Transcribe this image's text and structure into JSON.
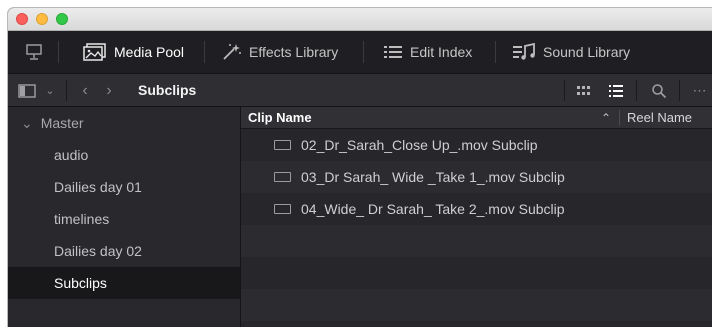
{
  "toolbar": {
    "media_pool": "Media Pool",
    "effects_library": "Effects Library",
    "edit_index": "Edit Index",
    "sound_library": "Sound Library"
  },
  "pathbar": {
    "title": "Subclips"
  },
  "sidebar": {
    "root": "Master",
    "items": [
      {
        "label": "audio"
      },
      {
        "label": "Dailies day 01"
      },
      {
        "label": "timelines"
      },
      {
        "label": "Dailies day 02"
      },
      {
        "label": "Subclips",
        "selected": true
      }
    ]
  },
  "table": {
    "columns": [
      "Clip Name",
      "Reel Name"
    ],
    "rows": [
      {
        "clip_name": "02_Dr_Sarah_Close Up_.mov Subclip"
      },
      {
        "clip_name": "03_Dr Sarah_ Wide _Take 1_.mov Subclip"
      },
      {
        "clip_name": "04_Wide_ Dr Sarah_ Take 2_.mov Subclip"
      }
    ]
  }
}
